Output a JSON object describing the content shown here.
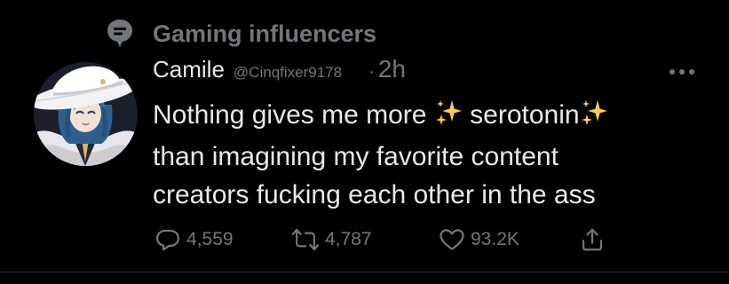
{
  "context": {
    "icon": "community-chat-icon",
    "label": "Gaming influencers"
  },
  "author": {
    "display_name": "Camile",
    "handle": "@Cinqfixer9178",
    "separator": "·",
    "time": "2h",
    "avatar": "anime-character-avatar"
  },
  "tweet": {
    "line1_a": "Nothing gives me more ",
    "line1_b": " serotonin",
    "sparkle_icon": "sparkles-icon",
    "line2": "than imagining my favorite content",
    "line3": "creators fucking each other in the ass"
  },
  "actions": {
    "replies": "4,559",
    "retweets": "4,787",
    "likes": "93.2K",
    "reply_icon": "reply-icon",
    "retweet_icon": "retweet-icon",
    "like_icon": "heart-icon",
    "share_icon": "share-icon",
    "more_icon": "more-icon"
  },
  "colors": {
    "background": "#000000",
    "primary_text": "#e7e9ea",
    "secondary_text": "#71767b",
    "sparkle": "#ffcc4d",
    "divider": "#2f3336"
  }
}
